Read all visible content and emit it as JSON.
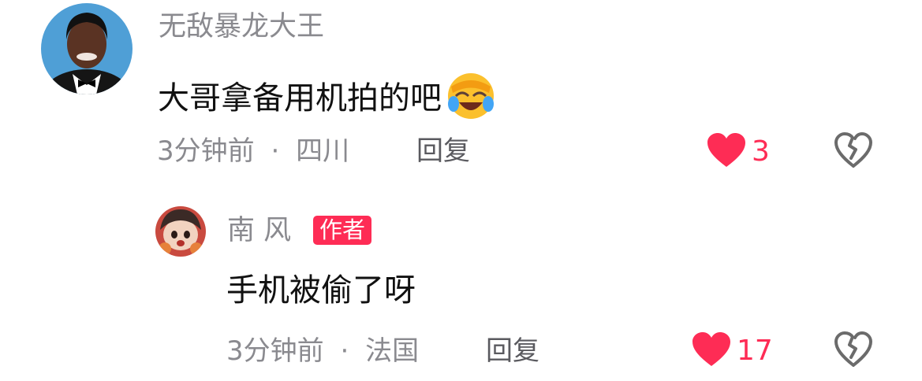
{
  "comment": {
    "username": "无敌暴龙大王",
    "text": "大哥拿备用机拍的吧",
    "emoji": "face-with-tears-of-joy-icon",
    "time": "3分钟前",
    "location": "四川",
    "meta_separator": "·",
    "reply_label": "回复",
    "like_count": "3"
  },
  "reply": {
    "username": "南 风",
    "badge": "作者",
    "text": "手机被偷了呀",
    "time": "3分钟前",
    "location": "法国",
    "meta_separator": "·",
    "reply_label": "回复",
    "like_count": "17"
  },
  "colors": {
    "like": "#fe2c55",
    "badge": "#fe2c55",
    "meta_text": "#8a8a8f",
    "body_text": "#111111"
  }
}
